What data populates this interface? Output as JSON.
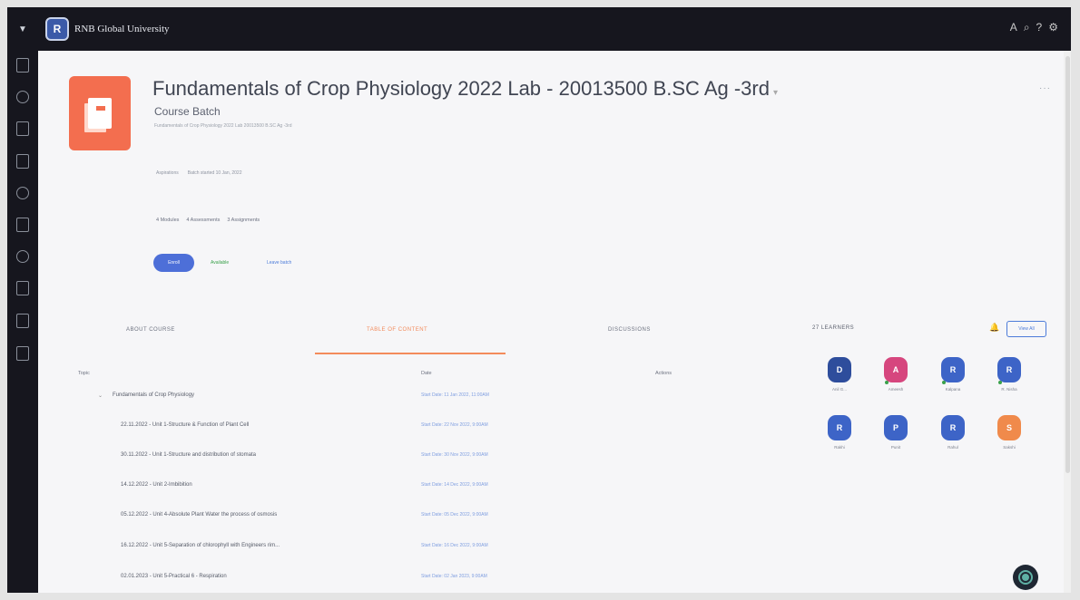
{
  "topbar": {
    "org_name": "RNB Global University",
    "logo_letter": "R",
    "right_icons": [
      "user-icon",
      "search-icon",
      "help-icon",
      "settings-icon"
    ],
    "right_glyphs": [
      "A",
      "⌕",
      "?",
      "⚙"
    ]
  },
  "course": {
    "title": "Fundamentals of Crop Physiology 2022 Lab - 20013500 B.SC Ag -3rd",
    "type_label": "Course Batch",
    "small_description": "Fundamentals of Crop Physiology 2022 Lab 20013500 B.SC Ag -3rd",
    "meta": [
      "Aspirations",
      "Batch started 10 Jan, 2022"
    ],
    "stats": [
      "4 Modules",
      "4 Assessments",
      "3 Assignments"
    ],
    "enroll_button": "Enroll",
    "status": "Available",
    "status_link": "Leave batch"
  },
  "tabs": [
    {
      "label": "ABOUT COURSE",
      "active": false
    },
    {
      "label": "TABLE OF CONTENT",
      "active": true
    },
    {
      "label": "DISCUSSIONS",
      "active": false
    }
  ],
  "table": {
    "headers": [
      "Topic",
      "Date",
      "Actions"
    ],
    "rows": [
      {
        "title": "Fundamentals of Crop Physiology",
        "date": "Start Date: 11 Jan 2022, 11:00AM"
      },
      {
        "title": "22.11.2022 - Unit 1-Structure & Function of Plant Cell",
        "date": "Start Date: 22 Nov 2022, 9:00AM"
      },
      {
        "title": "30.11.2022 - Unit 1-Structure and distribution of stomata",
        "date": "Start Date: 30 Nov 2022, 9:00AM"
      },
      {
        "title": "14.12.2022 - Unit 2-Imbibition",
        "date": "Start Date: 14 Dec 2022, 9:00AM"
      },
      {
        "title": "05.12.2022 - Unit 4-Absolute Plant Water the process of osmosis",
        "date": "Start Date: 05 Dec 2022, 9:00AM"
      },
      {
        "title": "16.12.2022 - Unit 5-Separation of chlorophyll with Engineers rim...",
        "date": "Start Date: 16 Dec 2022, 9:00AM"
      },
      {
        "title": "02.01.2023 - Unit 5-Practical 6 - Respiration",
        "date": "Start Date: 02 Jan 2023, 9:00AM"
      }
    ]
  },
  "learners": {
    "title": "27 LEARNERS",
    "view_button": "View All",
    "items": [
      {
        "initial": "D",
        "name": "Anil G...",
        "color": "#2e4d9c"
      },
      {
        "initial": "A",
        "name": "Ameesh",
        "color": "#d6467e"
      },
      {
        "initial": "R",
        "name": "Kalpana",
        "color": "#3d64c7"
      },
      {
        "initial": "R",
        "name": "R. Nisha",
        "color": "#3d64c7"
      },
      {
        "initial": "R",
        "name": "Rakhi",
        "color": "#3d64c7"
      },
      {
        "initial": "P",
        "name": "Punit",
        "color": "#3d64c7"
      },
      {
        "initial": "R",
        "name": "Rahul",
        "color": "#3d64c7"
      },
      {
        "initial": "S",
        "name": "Sakshi",
        "color": "#f08a4b"
      }
    ]
  }
}
